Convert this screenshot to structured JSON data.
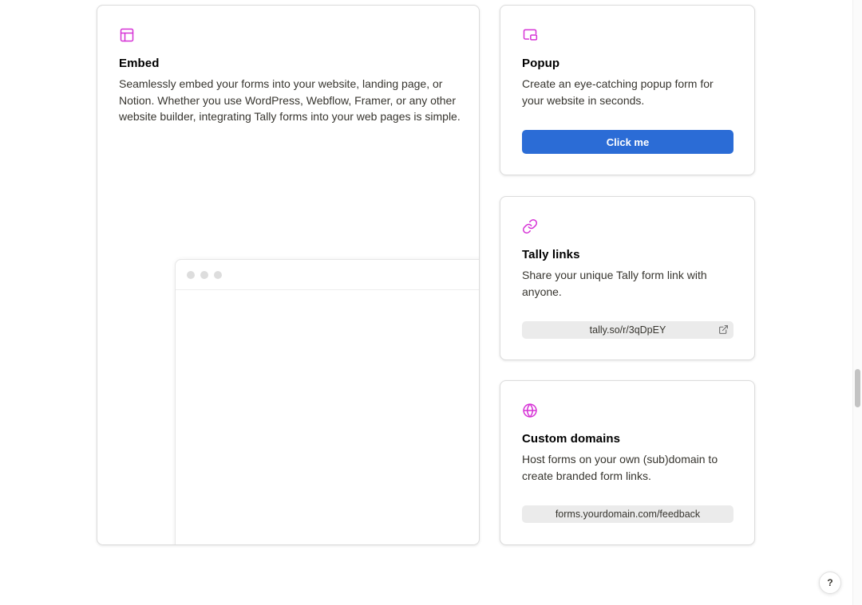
{
  "colors": {
    "accent_icon": "#d632d6",
    "primary_button": "#2b6cd6"
  },
  "cards": {
    "embed": {
      "icon": "layout-icon",
      "title": "Embed",
      "description": "Seamlessly embed your forms into your website, landing page, or Notion. Whether you use WordPress, Webflow, Framer, or any other website builder, integrating Tally forms into your web pages is simple."
    },
    "popup": {
      "icon": "picture-in-picture-icon",
      "title": "Popup",
      "description": "Create an eye-catching popup form for your website in seconds.",
      "button_label": "Click me"
    },
    "links": {
      "icon": "link-icon",
      "title": "Tally links",
      "description": "Share your unique Tally form link with anyone.",
      "link_text": "tally.so/r/3qDpEY"
    },
    "domains": {
      "icon": "globe-icon",
      "title": "Custom domains",
      "description": "Host forms on your own (sub)domain to create branded form links.",
      "domain_text": "forms.yourdomain.com/feedback"
    }
  },
  "help": {
    "label": "?"
  }
}
